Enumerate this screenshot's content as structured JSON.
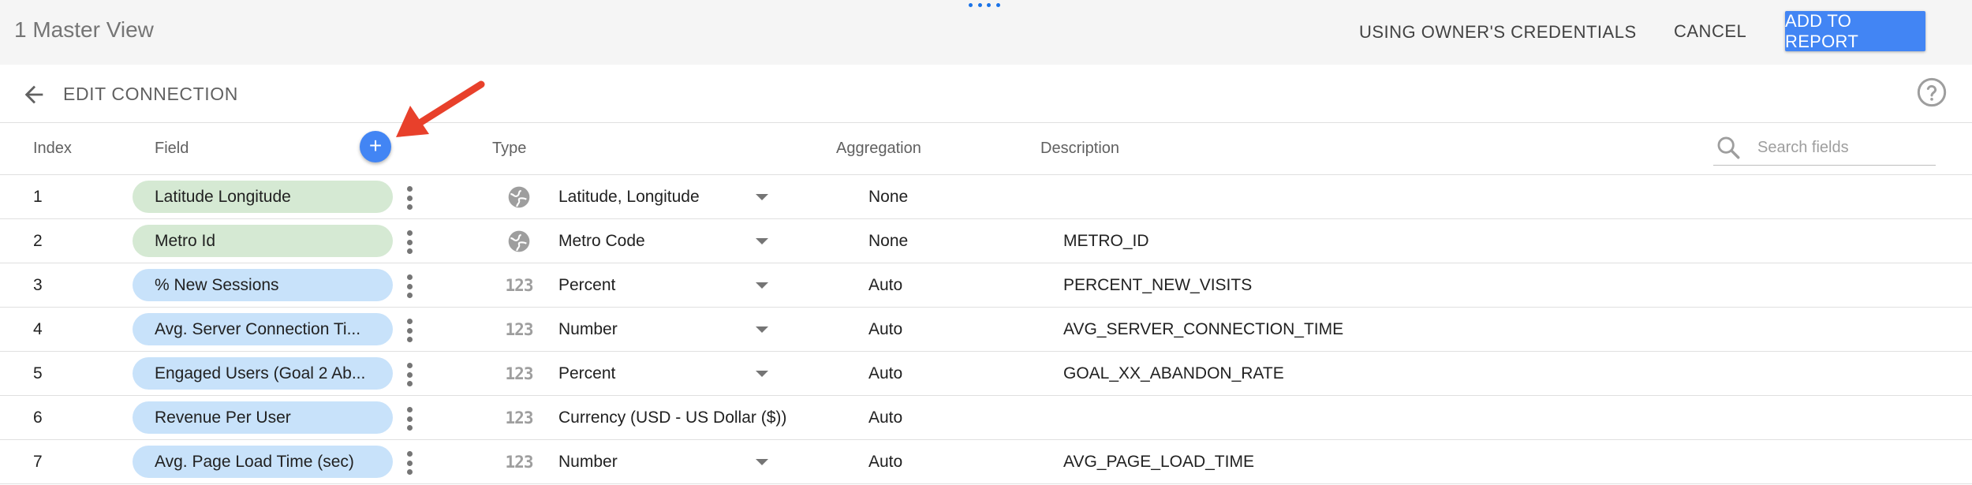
{
  "app": {
    "title": "1 Master View",
    "credentials_label": "USING OWNER'S CREDENTIALS",
    "cancel_label": "CANCEL",
    "add_to_report_label": "ADD TO REPORT"
  },
  "header": {
    "title": "EDIT CONNECTION",
    "back_icon": "arrow-back-icon",
    "help_icon": "help-circle-icon"
  },
  "columns": {
    "index": "Index",
    "field": "Field",
    "type": "Type",
    "aggregation": "Aggregation",
    "description": "Description"
  },
  "search": {
    "placeholder": "Search fields",
    "value": ""
  },
  "colors": {
    "accent": "#4285f4",
    "dimension_pill": "#d5e9d3",
    "metric_pill": "#c8e2fa",
    "annotation": "#e8402b"
  },
  "rows": [
    {
      "index": "1",
      "field": "Latitude Longitude",
      "kind": "dimension",
      "type_icon": "globe-icon",
      "type": "Latitude, Longitude",
      "aggregation": "None",
      "description": ""
    },
    {
      "index": "2",
      "field": "Metro Id",
      "kind": "dimension",
      "type_icon": "globe-icon",
      "type": "Metro Code",
      "aggregation": "None",
      "description": "METRO_ID"
    },
    {
      "index": "3",
      "field": "% New Sessions",
      "kind": "metric",
      "type_icon": "number-icon",
      "type": "Percent",
      "aggregation": "Auto",
      "description": "PERCENT_NEW_VISITS"
    },
    {
      "index": "4",
      "field": "Avg. Server Connection Ti...",
      "kind": "metric",
      "type_icon": "number-icon",
      "type": "Number",
      "aggregation": "Auto",
      "description": "AVG_SERVER_CONNECTION_TIME"
    },
    {
      "index": "5",
      "field": "Engaged Users (Goal 2 Ab...",
      "kind": "metric",
      "type_icon": "number-icon",
      "type": "Percent",
      "aggregation": "Auto",
      "description": "GOAL_XX_ABANDON_RATE"
    },
    {
      "index": "6",
      "field": "Revenue Per User",
      "kind": "metric",
      "type_icon": "number-icon",
      "type": "Currency (USD - US Dollar ($))",
      "aggregation": "Auto",
      "description": ""
    },
    {
      "index": "7",
      "field": "Avg. Page Load Time (sec)",
      "kind": "metric",
      "type_icon": "number-icon",
      "type": "Number",
      "aggregation": "Auto",
      "description": "AVG_PAGE_LOAD_TIME"
    }
  ]
}
